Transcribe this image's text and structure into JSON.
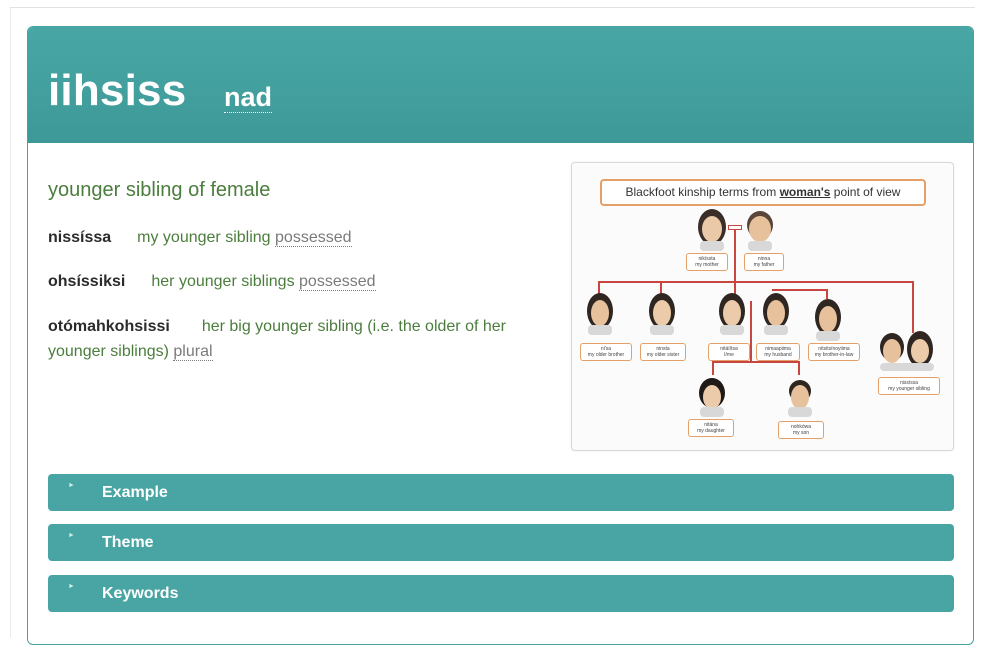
{
  "entry": {
    "headword": "iihsiss",
    "part_of_speech": "nad",
    "definition": "younger sibling of female"
  },
  "forms": [
    {
      "word": "nissíssa",
      "gloss": "my younger sibling",
      "tag": "possessed"
    },
    {
      "word": "ohsíssiksi",
      "gloss": "her younger siblings",
      "tag": "possessed"
    },
    {
      "word": "otómahkohsissi",
      "gloss": "her big younger sibling (i.e. the older of her younger siblings)",
      "tag": "plural"
    }
  ],
  "diagram": {
    "title_prefix": "Blackfoot kinship terms from ",
    "title_emphasis": "woman's",
    "title_suffix": " point of view",
    "labels": {
      "mother": [
        "nikíssta",
        "my mother"
      ],
      "father": [
        "ninna",
        "my father"
      ],
      "older_brother": [
        "ni'sa",
        "my older brother"
      ],
      "older_sister": [
        "ninsta",
        "my older sister"
      ],
      "self": [
        "nitáíítsa",
        "I/me"
      ],
      "husband": [
        "nimaapiima",
        "my husband"
      ],
      "brother_in_law": [
        "nitsitsínoyiima",
        "my brother-in-law"
      ],
      "younger_sibling": [
        "nissíssa",
        "my younger sibling"
      ],
      "daughter": [
        "nitána",
        "my daughter"
      ],
      "son": [
        "nohkówa",
        "my son"
      ]
    }
  },
  "sections": [
    {
      "label": "Example"
    },
    {
      "label": "Theme"
    },
    {
      "label": "Keywords"
    }
  ],
  "colors": {
    "header": "#46a3a1",
    "definition_green": "#4b7d3d",
    "diagram_line": "#c9453f",
    "label_border": "#e4a069"
  },
  "icons": {
    "section_caret": "caret-right-icon"
  }
}
